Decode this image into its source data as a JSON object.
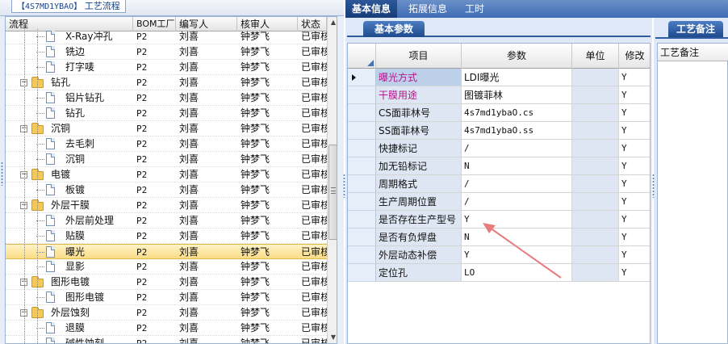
{
  "left_panel": {
    "title_code": "【4S7MD1YBAO】",
    "title_label": "工艺流程",
    "columns": [
      "流程",
      "BOM工厂",
      "编写人",
      "核审人",
      "状态"
    ],
    "rows": [
      {
        "label": "X-Ray冲孔",
        "level": 2,
        "type": "item",
        "bom": "P2",
        "author": "刘喜",
        "reviewer": "钟梦飞",
        "status": "已审核"
      },
      {
        "label": "铣边",
        "level": 2,
        "type": "item",
        "bom": "P2",
        "author": "刘喜",
        "reviewer": "钟梦飞",
        "status": "已审核"
      },
      {
        "label": "打字唛",
        "level": 2,
        "type": "item",
        "bom": "P2",
        "author": "刘喜",
        "reviewer": "钟梦飞",
        "status": "已审核"
      },
      {
        "label": "钻孔",
        "level": 1,
        "type": "group",
        "bom": "P2",
        "author": "刘喜",
        "reviewer": "钟梦飞",
        "status": "已审核"
      },
      {
        "label": "铝片钻孔",
        "level": 2,
        "type": "item",
        "bom": "P2",
        "author": "刘喜",
        "reviewer": "钟梦飞",
        "status": "已审核"
      },
      {
        "label": "钻孔",
        "level": 2,
        "type": "item",
        "bom": "P2",
        "author": "刘喜",
        "reviewer": "钟梦飞",
        "status": "已审核"
      },
      {
        "label": "沉铜",
        "level": 1,
        "type": "group",
        "bom": "P2",
        "author": "刘喜",
        "reviewer": "钟梦飞",
        "status": "已审核"
      },
      {
        "label": "去毛刺",
        "level": 2,
        "type": "item",
        "bom": "P2",
        "author": "刘喜",
        "reviewer": "钟梦飞",
        "status": "已审核"
      },
      {
        "label": "沉铜",
        "level": 2,
        "type": "item",
        "bom": "P2",
        "author": "刘喜",
        "reviewer": "钟梦飞",
        "status": "已审核"
      },
      {
        "label": "电镀",
        "level": 1,
        "type": "group",
        "bom": "P2",
        "author": "刘喜",
        "reviewer": "钟梦飞",
        "status": "已审核"
      },
      {
        "label": "板镀",
        "level": 2,
        "type": "item",
        "bom": "P2",
        "author": "刘喜",
        "reviewer": "钟梦飞",
        "status": "已审核"
      },
      {
        "label": "外层干膜",
        "level": 1,
        "type": "group",
        "bom": "P2",
        "author": "刘喜",
        "reviewer": "钟梦飞",
        "status": "已审核"
      },
      {
        "label": "外层前处理",
        "level": 2,
        "type": "item",
        "bom": "P2",
        "author": "刘喜",
        "reviewer": "钟梦飞",
        "status": "已审核"
      },
      {
        "label": "贴膜",
        "level": 2,
        "type": "item",
        "bom": "P2",
        "author": "刘喜",
        "reviewer": "钟梦飞",
        "status": "已审核"
      },
      {
        "label": "曝光",
        "level": 2,
        "type": "item",
        "bom": "P2",
        "author": "刘喜",
        "reviewer": "钟梦飞",
        "status": "已审核",
        "selected": true
      },
      {
        "label": "显影",
        "level": 2,
        "type": "item",
        "bom": "P2",
        "author": "刘喜",
        "reviewer": "钟梦飞",
        "status": "已审核"
      },
      {
        "label": "图形电镀",
        "level": 1,
        "type": "group",
        "bom": "P2",
        "author": "刘喜",
        "reviewer": "钟梦飞",
        "status": "已审核"
      },
      {
        "label": "图形电镀",
        "level": 2,
        "type": "item",
        "bom": "P2",
        "author": "刘喜",
        "reviewer": "钟梦飞",
        "status": "已审核"
      },
      {
        "label": "外层蚀刻",
        "level": 1,
        "type": "group",
        "bom": "P2",
        "author": "刘喜",
        "reviewer": "钟梦飞",
        "status": "已审核"
      },
      {
        "label": "退膜",
        "level": 2,
        "type": "item",
        "bom": "P2",
        "author": "刘喜",
        "reviewer": "钟梦飞",
        "status": "已审核"
      },
      {
        "label": "碱性蚀刻",
        "level": 2,
        "type": "item",
        "bom": "P2",
        "author": "刘喜",
        "reviewer": "钟梦飞",
        "status": "已审核"
      }
    ]
  },
  "top_tabs": [
    {
      "label": "基本信息",
      "active": true
    },
    {
      "label": "拓展信息",
      "active": false
    },
    {
      "label": "工时",
      "active": false
    }
  ],
  "params_panel": {
    "tab_label": "基本参数",
    "columns": [
      "项目",
      "参数",
      "单位",
      "修改"
    ],
    "rows": [
      {
        "item": "曝光方式",
        "value": "LDI曝光",
        "unit": "",
        "modify": "Y",
        "item_color": "pink",
        "highlight": true,
        "current": true
      },
      {
        "item": "干膜用途",
        "value": "图镀菲林",
        "unit": "",
        "modify": "Y",
        "item_color": "pink"
      },
      {
        "item": "CS面菲林号",
        "value": "4s7md1ybaO.cs",
        "unit": "",
        "modify": "Y"
      },
      {
        "item": "SS面菲林号",
        "value": "4s7md1ybaO.ss",
        "unit": "",
        "modify": "Y"
      },
      {
        "item": "快捷标记",
        "value": "/",
        "unit": "",
        "modify": "Y"
      },
      {
        "item": "加无铅标记",
        "value": "N",
        "unit": "",
        "modify": "Y"
      },
      {
        "item": "周期格式",
        "value": "/",
        "unit": "",
        "modify": "Y"
      },
      {
        "item": "生产周期位置",
        "value": "/",
        "unit": "",
        "modify": "Y"
      },
      {
        "item": "是否存在生产型号",
        "value": "Y",
        "unit": "",
        "modify": "Y"
      },
      {
        "item": "是否有负焊盘",
        "value": "N",
        "unit": "",
        "modify": "Y"
      },
      {
        "item": "外层动态补偿",
        "value": "Y",
        "unit": "",
        "modify": "Y"
      },
      {
        "item": "定位孔",
        "value": "LO",
        "unit": "",
        "modify": "Y"
      }
    ]
  },
  "notes_panel": {
    "tab_label": "工艺备注",
    "header": "工艺备注"
  },
  "colors": {
    "accent": "#2e5c9f",
    "selected_row": "#fbdc86",
    "pink_text": "#b5158a",
    "annotation_arrow": "#e87c7c"
  }
}
